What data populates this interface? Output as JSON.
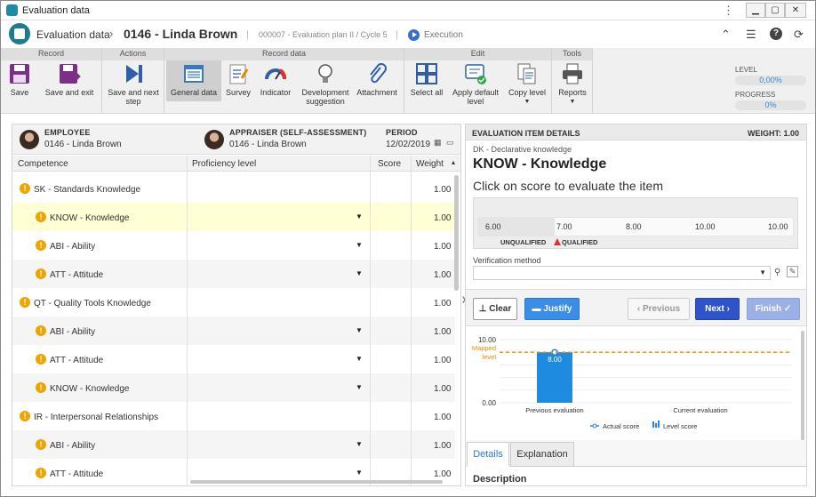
{
  "window": {
    "title": "Evaluation data"
  },
  "header": {
    "crumb1": "Evaluation data",
    "crumb2": "0146 - Linda Brown",
    "plan": "000007 - Evaluation plan II / Cycle 5",
    "status": "Execution"
  },
  "ribbon": {
    "groups": [
      "Record",
      "Actions",
      "Record data",
      "Edit",
      "Tools"
    ],
    "save": "Save",
    "save_exit": "Save and exit",
    "save_next_1": "Save and next",
    "save_next_2": "step",
    "general_data": "General data",
    "survey": "Survey",
    "indicator": "Indicator",
    "dev_1": "Development",
    "dev_2": "suggestion",
    "attachment": "Attachment",
    "select_all": "Select all",
    "apply_1": "Apply default",
    "apply_2": "level",
    "copy_level": "Copy level",
    "reports": "Reports",
    "level_label": "LEVEL",
    "level_value": "0,00%",
    "progress_label": "PROGRESS",
    "progress_value": "0%"
  },
  "panel": {
    "employee_label": "EMPLOYEE",
    "employee_value": "0146 - Linda Brown",
    "appraiser_label": "APPRAISER (SELF-ASSESSMENT)",
    "appraiser_value": "0146 - Linda Brown",
    "period_label": "PERIOD",
    "period_value": "12/02/2019"
  },
  "table": {
    "headers": {
      "competence": "Competence",
      "proficiency": "Proficiency level",
      "score": "Score",
      "weight": "Weight"
    },
    "rows": [
      {
        "name": "SK - Standards Knowledge",
        "weight": "1.00"
      },
      {
        "name": "KNOW - Knowledge",
        "weight": "1.00"
      },
      {
        "name": "ABI - Ability",
        "weight": "1.00"
      },
      {
        "name": "ATT - Attitude",
        "weight": "1.00"
      },
      {
        "name": "QT - Quality Tools Knowledge",
        "weight": "1.00"
      },
      {
        "name": "ABI - Ability",
        "weight": "1.00"
      },
      {
        "name": "ATT - Attitude",
        "weight": "1.00"
      },
      {
        "name": "KNOW - Knowledge",
        "weight": "1.00"
      },
      {
        "name": "IR - Interpersonal Relationships",
        "weight": "1.00"
      },
      {
        "name": "ABI - Ability",
        "weight": "1.00"
      },
      {
        "name": "ATT - Attitude",
        "weight": "1.00"
      }
    ]
  },
  "details": {
    "title": "EVALUATION ITEM DETAILS",
    "weight": "WEIGHT: 1.00",
    "category": "DK - Declarative knowledge",
    "item": "KNOW - Knowledge",
    "instruction": "Click on score to evaluate the item",
    "ticks": [
      "6.00",
      "7.00",
      "8.00",
      "10.00",
      "10.00"
    ],
    "unqualified": "UNQUALIFIED",
    "qualified": "QUALIFIED",
    "verification_label": "Verification method",
    "clear": "Clear",
    "justify": "Justify",
    "previous": "Previous",
    "next": "Next",
    "finish": "Finish",
    "tab_details": "Details",
    "tab_explanation": "Explanation",
    "description": "Description"
  },
  "chart_data": {
    "type": "bar",
    "categories": [
      "Previous evaluation",
      "Current evaluation"
    ],
    "series": [
      {
        "name": "Actual score",
        "values": [
          null,
          null
        ]
      },
      {
        "name": "Level score",
        "values": [
          8.0,
          null
        ]
      }
    ],
    "bar_label": "8.00",
    "reference_line": {
      "label": "Mapped level",
      "value": 8.0
    },
    "ylim": [
      0,
      10
    ],
    "y_ticks": [
      "10.00",
      "0.00"
    ],
    "legend": "bottom"
  }
}
